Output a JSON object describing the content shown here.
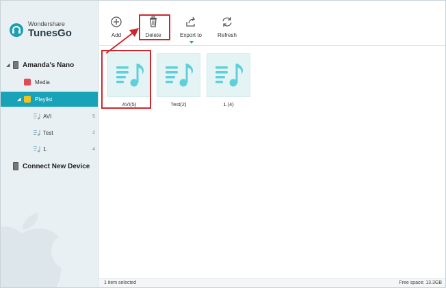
{
  "app": {
    "brand": "Wondershare",
    "product": "TunesGo"
  },
  "toolbar": {
    "add_label": "Add",
    "delete_label": "Delete",
    "export_label": "Export to",
    "refresh_label": "Refresh"
  },
  "sidebar": {
    "device_name": "Amanda's Nano",
    "media_label": "Media",
    "playlist_label": "Playlist",
    "playlists": [
      {
        "label": "AVI",
        "count": "5"
      },
      {
        "label": "Test",
        "count": "2"
      },
      {
        "label": "1.",
        "count": "4"
      }
    ],
    "connect_label": "Connect New Device"
  },
  "tiles": [
    {
      "label": "AVI(5)"
    },
    {
      "label": "Test(2)"
    },
    {
      "label": "1.(4)"
    }
  ],
  "status": {
    "selection": "1 item selected",
    "free_space": "Free space: 13.3GB"
  },
  "colors": {
    "accent": "#19a3b8",
    "highlight": "#d0262d",
    "sidebar_bg": "#e9f0f3",
    "tile_bg": "#e4f4f5",
    "music_icon": "#5fcfd9"
  }
}
